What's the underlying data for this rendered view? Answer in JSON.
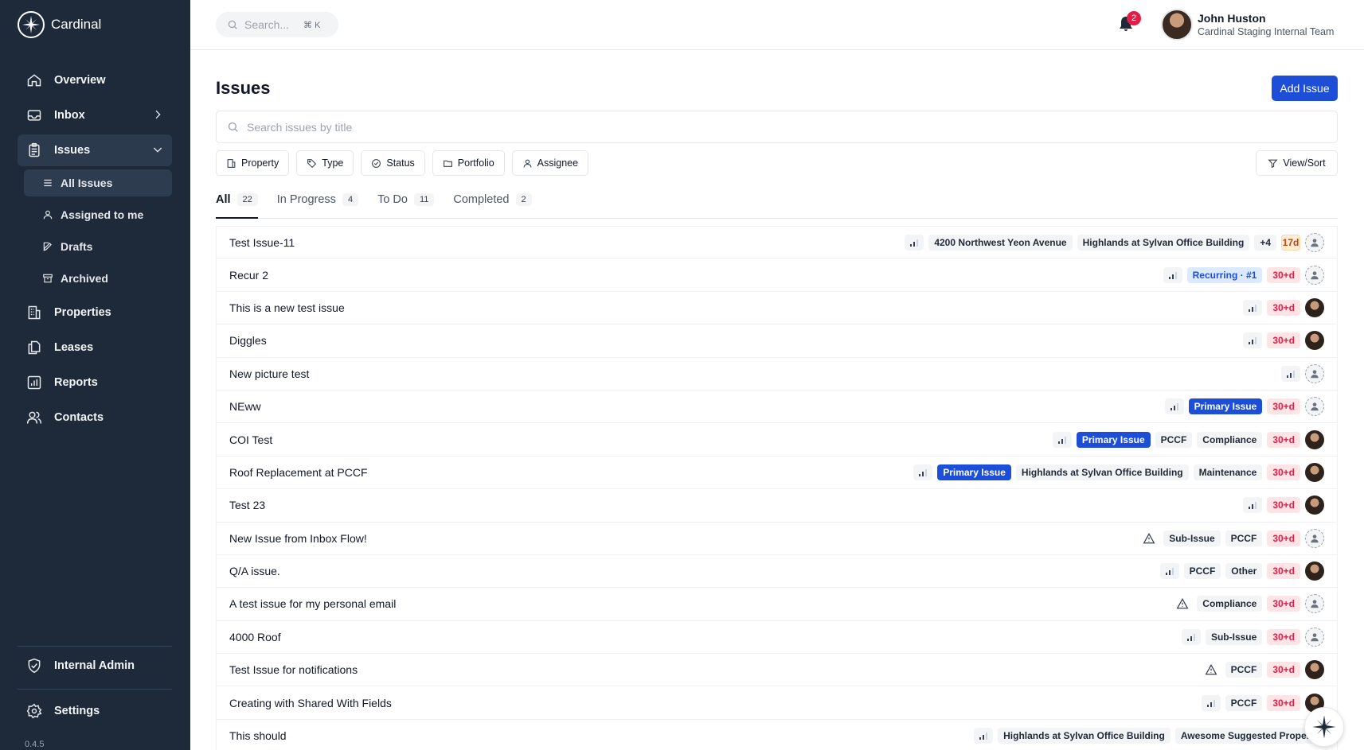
{
  "app": {
    "name": "Cardinal",
    "version": "0.4.5"
  },
  "sidebar": {
    "items": [
      {
        "label": "Overview",
        "icon": "home-icon"
      },
      {
        "label": "Inbox",
        "icon": "inbox-icon"
      },
      {
        "label": "Issues",
        "icon": "clipboard-icon"
      },
      {
        "label": "Properties",
        "icon": "building-icon"
      },
      {
        "label": "Leases",
        "icon": "documents-icon"
      },
      {
        "label": "Reports",
        "icon": "bar-chart-icon"
      },
      {
        "label": "Contacts",
        "icon": "users-icon"
      }
    ],
    "issues_sub": [
      {
        "label": "All Issues",
        "icon": "list-icon"
      },
      {
        "label": "Assigned to me",
        "icon": "user-icon"
      },
      {
        "label": "Drafts",
        "icon": "pencil-icon"
      },
      {
        "label": "Archived",
        "icon": "archive-icon"
      }
    ],
    "internal_admin": "Internal Admin",
    "settings": "Settings"
  },
  "header": {
    "search_placeholder": "Search...",
    "search_shortcut": "⌘ K",
    "notification_count": "2",
    "user_name": "John Huston",
    "user_team": "Cardinal Staging Internal Team"
  },
  "main": {
    "title": "Issues",
    "add_button": "Add Issue",
    "search_placeholder": "Search issues by title",
    "filters": [
      "Property",
      "Type",
      "Status",
      "Portfolio",
      "Assignee"
    ],
    "view_sort": "View/Sort",
    "tabs": [
      {
        "label": "All",
        "count": "22"
      },
      {
        "label": "In Progress",
        "count": "4"
      },
      {
        "label": "To Do",
        "count": "11"
      },
      {
        "label": "Completed",
        "count": "2"
      }
    ]
  },
  "issues": [
    {
      "title": "Test Issue-11",
      "marker": "priority",
      "tags": [
        "4200 Northwest Yeon Avenue",
        "Highlands at Sylvan Office Building",
        "+4"
      ],
      "age": "17d",
      "age_style": "warn",
      "assignee": "empty"
    },
    {
      "title": "Recur 2",
      "marker": "priority",
      "tags": [
        "Recurring · #1"
      ],
      "age": "30+d",
      "age_style": "late",
      "assignee": "empty"
    },
    {
      "title": "This is a new test issue",
      "marker": "priority",
      "tags": [],
      "age": "30+d",
      "age_style": "late",
      "assignee": "photo"
    },
    {
      "title": "Diggles",
      "marker": "priority",
      "tags": [],
      "age": "30+d",
      "age_style": "late",
      "assignee": "photo"
    },
    {
      "title": "New picture test",
      "marker": "priority",
      "tags": [],
      "age": "",
      "age_style": "",
      "assignee": "empty"
    },
    {
      "title": "NEww",
      "marker": "priority",
      "tags": [
        "Primary Issue"
      ],
      "age": "30+d",
      "age_style": "late",
      "assignee": "empty"
    },
    {
      "title": "COI Test",
      "marker": "priority",
      "tags": [
        "Primary Issue",
        "PCCF",
        "Compliance"
      ],
      "age": "30+d",
      "age_style": "late",
      "assignee": "photo"
    },
    {
      "title": "Roof Replacement at PCCF",
      "marker": "priority",
      "tags": [
        "Primary Issue",
        "Highlands at Sylvan Office Building",
        "Maintenance"
      ],
      "age": "30+d",
      "age_style": "late",
      "assignee": "photo"
    },
    {
      "title": "Test 23",
      "marker": "priority",
      "tags": [],
      "age": "30+d",
      "age_style": "late",
      "assignee": "photo"
    },
    {
      "title": "New Issue from Inbox Flow!",
      "marker": "urgent",
      "tags": [
        "Sub-Issue",
        "PCCF"
      ],
      "age": "30+d",
      "age_style": "late",
      "assignee": "empty"
    },
    {
      "title": "Q/A issue.",
      "marker": "priority",
      "tags": [
        "PCCF",
        "Other"
      ],
      "age": "30+d",
      "age_style": "late",
      "assignee": "photo"
    },
    {
      "title": "A test issue for my personal email",
      "marker": "urgent",
      "tags": [
        "Compliance"
      ],
      "age": "30+d",
      "age_style": "late",
      "assignee": "empty"
    },
    {
      "title": "4000 Roof",
      "marker": "priority",
      "tags": [
        "Sub-Issue"
      ],
      "age": "30+d",
      "age_style": "late",
      "assignee": "empty"
    },
    {
      "title": "Test Issue for notifications",
      "marker": "urgent",
      "tags": [
        "PCCF"
      ],
      "age": "30+d",
      "age_style": "late",
      "assignee": "photo"
    },
    {
      "title": "Creating with Shared With Fields",
      "marker": "priority",
      "tags": [
        "PCCF"
      ],
      "age": "30+d",
      "age_style": "late",
      "assignee": "photo"
    },
    {
      "title": "This should",
      "marker": "priority",
      "tags": [
        "Highlands at Sylvan Office Building",
        "Awesome Suggested Property"
      ],
      "age": "",
      "age_style": "",
      "assignee": "none"
    }
  ],
  "colors": {
    "sidebar_bg": "#1e2a3a",
    "accent": "#1d4ed8",
    "late": "#e11d48"
  }
}
